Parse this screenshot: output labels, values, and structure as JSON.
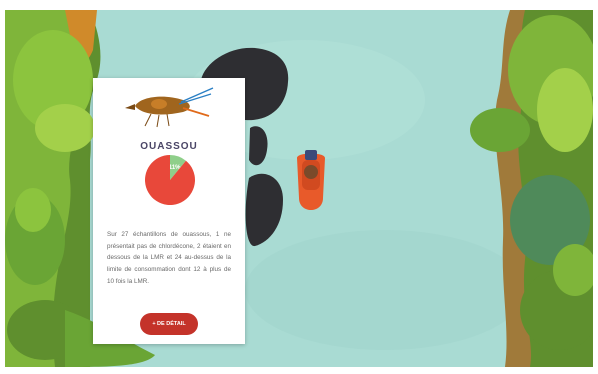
{
  "card": {
    "title": "OUASSOU",
    "description": "Sur 27 échantillons de ouassous, 1 ne présentait pas de chlordécone, 2 étaient en dessous de la LMR et 24 au-dessus de la limite de consommation dont 12 à plus de 10 fois la LMR.",
    "button_label": "+ DE DÉTAIL"
  },
  "chart_data": {
    "type": "pie",
    "slices": [
      {
        "label": "11%",
        "value": 11,
        "color": "#8fcf8a"
      },
      {
        "value": 89,
        "color": "#e8483a"
      }
    ]
  },
  "icons": [
    "crayfish-illustration",
    "boat-icon"
  ],
  "colors": {
    "water": "#a9dbd3",
    "vegetation": "#7fb53a",
    "rocks": "#2e2e32",
    "button": "#c4332a",
    "title": "#4a4566",
    "boat": "#e85a2a"
  }
}
